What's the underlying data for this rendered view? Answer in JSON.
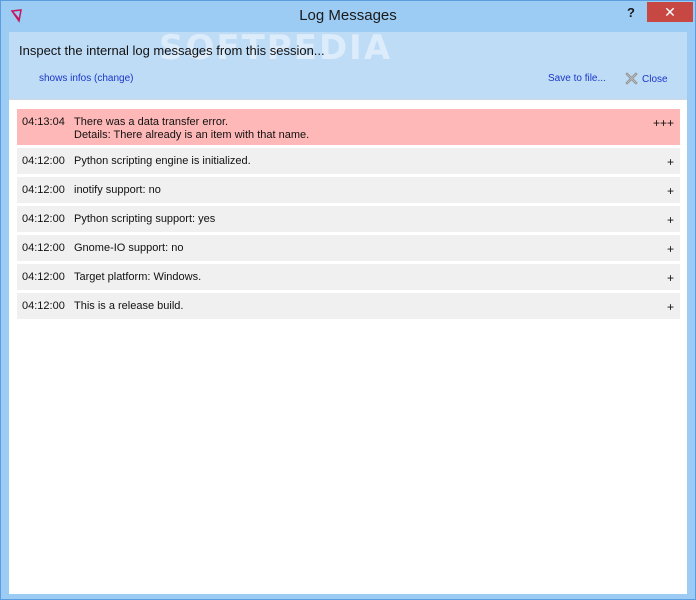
{
  "window": {
    "title": "Log Messages",
    "help_label": "?",
    "close_label": "✕"
  },
  "header": {
    "instruction": "Inspect the internal log messages from this session...",
    "watermark": "SOFTPEDIA",
    "shows_infos_link": "shows infos (change)",
    "save_link": "Save to file...",
    "close_link": "Close"
  },
  "log": {
    "rows": [
      {
        "time": "04:13:04",
        "message": "There was a data transfer error.",
        "detail": "Details: There already is an item with that name.",
        "expand": "+++",
        "level": "error"
      },
      {
        "time": "04:12:00",
        "message": "Python scripting engine is initialized.",
        "expand": "+",
        "level": "info"
      },
      {
        "time": "04:12:00",
        "message": "inotify support: no",
        "expand": "+",
        "level": "info"
      },
      {
        "time": "04:12:00",
        "message": "Python scripting support: yes",
        "expand": "+",
        "level": "info"
      },
      {
        "time": "04:12:00",
        "message": "Gnome-IO support: no",
        "expand": "+",
        "level": "info"
      },
      {
        "time": "04:12:00",
        "message": "Target platform: Windows.",
        "expand": "+",
        "level": "info"
      },
      {
        "time": "04:12:00",
        "message": "This is a release build.",
        "expand": "+",
        "level": "info"
      }
    ]
  },
  "colors": {
    "title_bar": "#9ccbf4",
    "error_row": "#ffb8b8",
    "normal_row": "#f0f0f0",
    "link": "#1a37c8",
    "close_button": "#c74743"
  }
}
